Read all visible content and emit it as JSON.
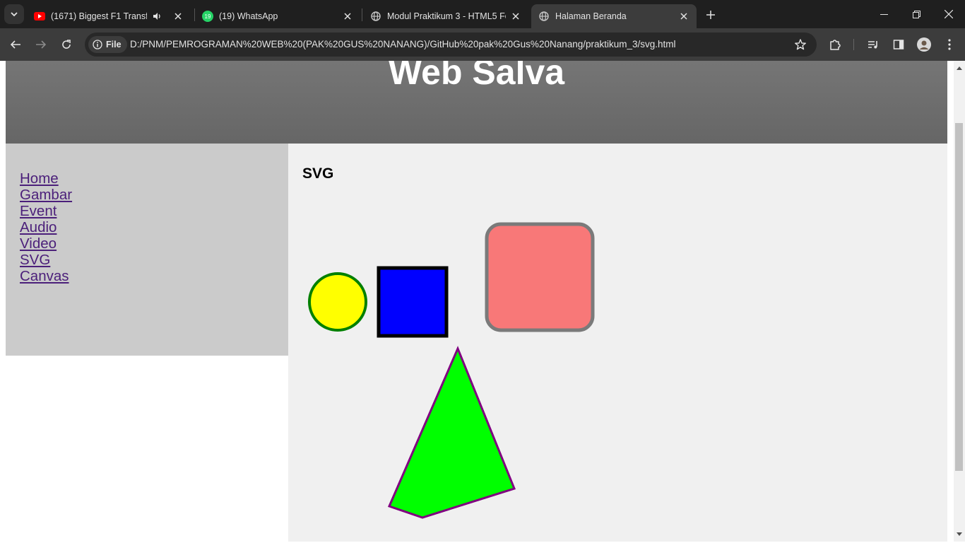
{
  "browser": {
    "tabs": [
      {
        "title": "(1671) Biggest F1 Transfer S",
        "icon": "youtube-icon",
        "audio": true
      },
      {
        "title": "(19) WhatsApp",
        "icon": "whatsapp-icon",
        "badge": "19"
      },
      {
        "title": "Modul Praktikum 3 - HTML5 Fo",
        "icon": "globe-icon"
      },
      {
        "title": "Halaman Beranda",
        "icon": "globe-icon",
        "active": true
      }
    ],
    "address": {
      "chip_label": "File",
      "url": "D:/PNM/PEMROGRAMAN%20WEB%20(PAK%20GUS%20NANANG)/GitHub%20pak%20Gus%20Nanang/praktikum_3/svg.html"
    }
  },
  "page": {
    "site_title": "Web Salva",
    "menu": [
      "Home",
      "Gambar",
      "Event",
      "Audio",
      "Video",
      "SVG",
      "Canvas"
    ],
    "section_title": "SVG"
  },
  "colors": {
    "header_bg": "#6e6e6e",
    "sidebar_bg": "#cbcbcb",
    "content_bg": "#f0f0f0",
    "link": "#4b1f7a",
    "circle_fill": "#ffff00",
    "circle_stroke": "#008000",
    "square_fill": "#0000ff",
    "square_stroke": "#000000",
    "rounded_rect_fill": "#f87878",
    "rounded_rect_stroke": "#7a7a7a",
    "polygon_fill": "#00ff00",
    "polygon_stroke": "#800080"
  }
}
